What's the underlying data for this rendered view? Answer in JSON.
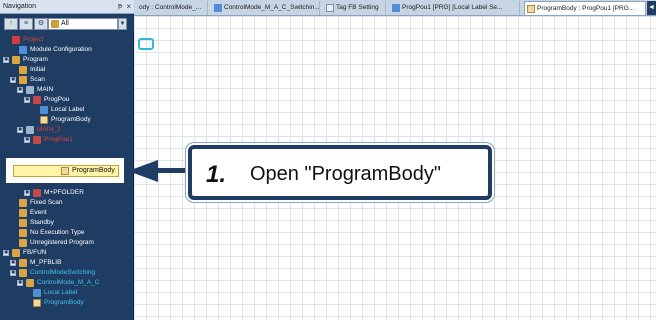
{
  "navigation": {
    "title": "Navigation",
    "pin_glyph": "ᵽ",
    "close_glyph": "×",
    "toolbar": {
      "filter_value": "All",
      "btn1": "↑",
      "btn2": "≡",
      "btn3": "⚙"
    },
    "tree": [
      {
        "label": "Project",
        "indent": 0,
        "style": "red",
        "icon": "project-icon"
      },
      {
        "label": "Module Configuration",
        "indent": 1,
        "style": "normal",
        "icon": "module-icon"
      },
      {
        "label": "Program",
        "indent": 0,
        "style": "normal",
        "icon": "folder-icon",
        "expander": "■"
      },
      {
        "label": "Initial",
        "indent": 1,
        "style": "normal",
        "icon": "folder-icon"
      },
      {
        "label": "Scan",
        "indent": 1,
        "style": "normal",
        "icon": "folder-icon",
        "expander": "■"
      },
      {
        "label": "MAIN",
        "indent": 2,
        "style": "normal",
        "icon": "gear-icon",
        "expander": "■"
      },
      {
        "label": "ProgPou",
        "indent": 3,
        "style": "normal",
        "icon": "program-icon",
        "expander": "■"
      },
      {
        "label": "Local Label",
        "indent": 4,
        "style": "normal",
        "icon": "label-icon"
      },
      {
        "label": "ProgramBody",
        "indent": 4,
        "style": "normal",
        "icon": "body-icon"
      },
      {
        "label": "MAIN_2",
        "indent": 2,
        "style": "red",
        "icon": "gear-icon",
        "expander": "■"
      },
      {
        "label": "ProgPou1",
        "indent": 3,
        "style": "red",
        "icon": "program-icon",
        "expander": "■"
      }
    ],
    "tree_lower": [
      {
        "label": "M+PFOLDER",
        "indent": 3,
        "style": "normal",
        "icon": "program-icon",
        "expander": "■"
      },
      {
        "label": "Fixed Scan",
        "indent": 1,
        "style": "normal",
        "icon": "folder-icon"
      },
      {
        "label": "Event",
        "indent": 1,
        "style": "normal",
        "icon": "folder-icon"
      },
      {
        "label": "Standby",
        "indent": 1,
        "style": "normal",
        "icon": "folder-icon"
      },
      {
        "label": "No Execution Type",
        "indent": 1,
        "style": "normal",
        "icon": "folder-icon"
      },
      {
        "label": "Unregistered Program",
        "indent": 1,
        "style": "normal",
        "icon": "folder-icon"
      },
      {
        "label": "FB/FUN",
        "indent": 0,
        "style": "normal",
        "icon": "folder-icon",
        "expander": "■"
      },
      {
        "label": "M_PFBLIB",
        "indent": 1,
        "style": "normal",
        "icon": "folder-icon",
        "expander": "■"
      },
      {
        "label": "ControlModeSwitching",
        "indent": 1,
        "style": "cyan",
        "icon": "folder-icon",
        "expander": "■"
      },
      {
        "label": "ControlMode_M_A_C",
        "indent": 2,
        "style": "cyan",
        "icon": "folder-icon",
        "expander": "■"
      },
      {
        "label": "Local Label",
        "indent": 3,
        "style": "cyan",
        "icon": "label-icon"
      },
      {
        "label": "ProgramBody",
        "indent": 3,
        "style": "cyan",
        "icon": "body-icon"
      }
    ],
    "selected_item": "ProgramBody"
  },
  "tabs": [
    {
      "label": "ody : ControlMode_..."
    },
    {
      "label": "ControlMode_M_A_C_Switchin..."
    },
    {
      "label": "Tag FB Setting"
    },
    {
      "label": "ProgPou1 [PRG] [Local Label Se..."
    },
    {
      "label": "ProgramBody : ProgPou1 [PRG..."
    }
  ],
  "tab_scroll_glyph": "◄",
  "callout": {
    "step_number": "1.",
    "instruction": "Open \"ProgramBody\""
  },
  "colors": {
    "nav_bg": "#1f3d63",
    "highlight": "#fff4a8",
    "accent": "#33b8d8"
  }
}
